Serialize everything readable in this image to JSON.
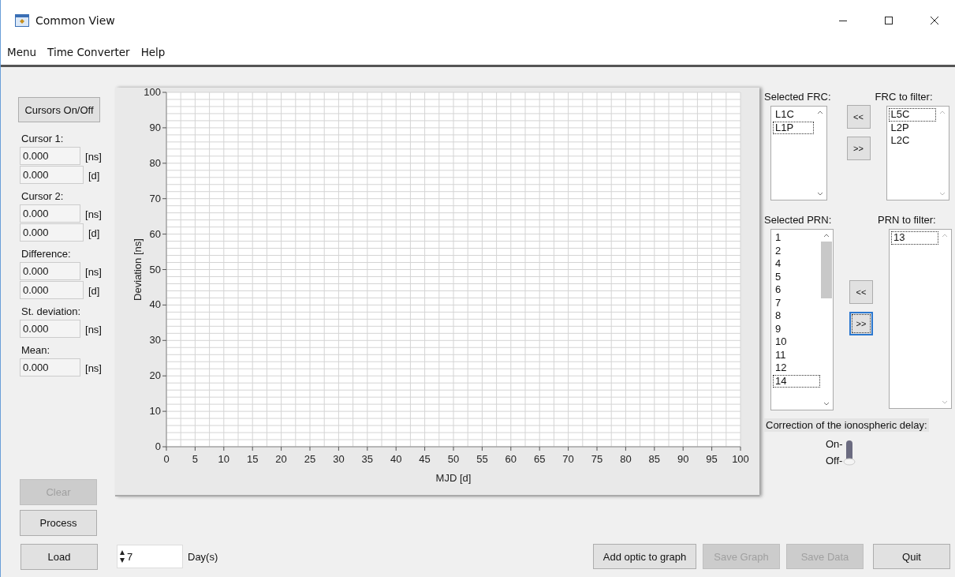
{
  "window": {
    "title": "Common View"
  },
  "menu": [
    "Menu",
    "Time Converter",
    "Help"
  ],
  "cursors_button": {
    "label": "Cursors On/Off",
    "disabled": false
  },
  "readouts": [
    {
      "label": "Cursor 1:",
      "fields": [
        {
          "value": "0.000",
          "unit": "[ns]"
        },
        {
          "value": "0.000",
          "unit": "[d]"
        }
      ]
    },
    {
      "label": "Cursor 2:",
      "fields": [
        {
          "value": "0.000",
          "unit": "[ns]"
        },
        {
          "value": "0.000",
          "unit": "[d]"
        }
      ]
    },
    {
      "label": "Difference:",
      "fields": [
        {
          "value": "0.000",
          "unit": "[ns]"
        },
        {
          "value": "0.000",
          "unit": "[d]"
        }
      ]
    },
    {
      "label": "St. deviation:",
      "fields": [
        {
          "value": "0.000",
          "unit": "[ns]"
        }
      ]
    },
    {
      "label": "Mean:",
      "fields": [
        {
          "value": "0.000",
          "unit": "[ns]"
        }
      ]
    }
  ],
  "left_buttons": [
    {
      "label": "Clear",
      "disabled": true
    },
    {
      "label": "Process",
      "disabled": false
    }
  ],
  "chart": {
    "chart_data": {
      "type": "line",
      "xlabel": "MJD [d]",
      "ylabel": "Deviation [ns]",
      "xlim": [
        0,
        100
      ],
      "ylim": [
        0,
        100
      ],
      "xticks": [
        0,
        5,
        10,
        15,
        20,
        25,
        30,
        35,
        40,
        45,
        50,
        55,
        60,
        65,
        70,
        75,
        80,
        85,
        90,
        95,
        100
      ],
      "yticks": [
        0,
        10,
        20,
        30,
        40,
        50,
        60,
        70,
        80,
        90,
        100
      ],
      "grid": true
    }
  },
  "frc": {
    "selected_label": "Selected FRC:",
    "filter_label": "FRC to filter:",
    "selected_items": [
      {
        "text": "L1C",
        "focused": false
      },
      {
        "text": "L1P",
        "focused": true
      }
    ],
    "filter_items": [
      {
        "text": "L5C",
        "focused": true
      },
      {
        "text": "L2P",
        "focused": false
      },
      {
        "text": "L2C",
        "focused": false
      }
    ],
    "buttons": [
      {
        "label": "<<",
        "focused": false
      },
      {
        "label": ">>",
        "focused": false
      }
    ]
  },
  "prn": {
    "selected_label": "Selected PRN:",
    "filter_label": "PRN to filter:",
    "selected_items": [
      {
        "text": "1",
        "focused": false
      },
      {
        "text": "2",
        "focused": false
      },
      {
        "text": "4",
        "focused": false
      },
      {
        "text": "5",
        "focused": false
      },
      {
        "text": "6",
        "focused": false
      },
      {
        "text": "7",
        "focused": false
      },
      {
        "text": "8",
        "focused": false
      },
      {
        "text": "9",
        "focused": false
      },
      {
        "text": "10",
        "focused": false
      },
      {
        "text": "11",
        "focused": false
      },
      {
        "text": "12",
        "focused": false
      },
      {
        "text": "14",
        "focused": true
      }
    ],
    "filter_items": [
      {
        "text": "13",
        "focused": true
      }
    ],
    "buttons": [
      {
        "label": "<<",
        "focused": false
      },
      {
        "label": ">>",
        "focused": true
      }
    ]
  },
  "ionosphere": {
    "label": "Correction of the ionospheric delay:",
    "on_label": "On-",
    "off_label": "Off-",
    "on": false
  },
  "load_button": {
    "label": "Load",
    "disabled": false
  },
  "days": {
    "value": "7",
    "unit": "Day(s)"
  },
  "bottom_buttons": [
    {
      "label": "Add optic to graph",
      "disabled": false
    },
    {
      "label": "Save Graph",
      "disabled": true
    },
    {
      "label": "Save Data",
      "disabled": true
    },
    {
      "label": "Quit",
      "disabled": false
    }
  ]
}
